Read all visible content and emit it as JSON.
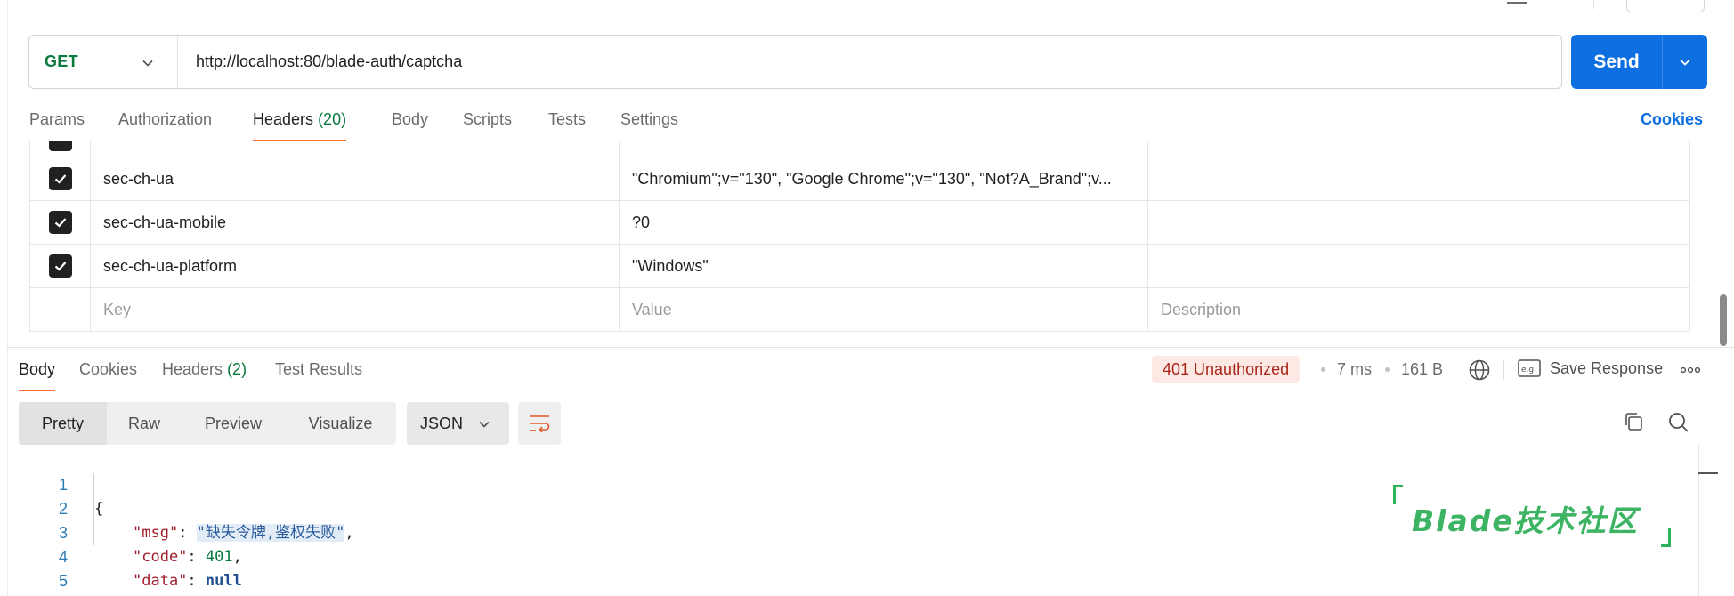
{
  "request": {
    "method": "GET",
    "url": "http://localhost:80/blade-auth/captcha",
    "send_label": "Send"
  },
  "request_tabs": {
    "params": "Params",
    "authorization": "Authorization",
    "headers": "Headers",
    "headers_count": "(20)",
    "body": "Body",
    "scripts": "Scripts",
    "tests": "Tests",
    "settings": "Settings",
    "active": "Headers",
    "cookies": "Cookies"
  },
  "headers_table": {
    "rows": [
      {
        "checked": true,
        "key": "sec-ch-ua",
        "value": "\"Chromium\";v=\"130\", \"Google Chrome\";v=\"130\", \"Not?A_Brand\";v...",
        "description": ""
      },
      {
        "checked": true,
        "key": "sec-ch-ua-mobile",
        "value": "?0",
        "description": ""
      },
      {
        "checked": true,
        "key": "sec-ch-ua-platform",
        "value": "\"Windows\"",
        "description": ""
      }
    ],
    "placeholders": {
      "key": "Key",
      "value": "Value",
      "description": "Description"
    }
  },
  "response_tabs": {
    "body": "Body",
    "cookies": "Cookies",
    "headers": "Headers",
    "headers_count": "(2)",
    "test_results": "Test Results",
    "active": "Body"
  },
  "response_meta": {
    "status": "401 Unauthorized",
    "time": "7 ms",
    "size": "161 B",
    "save_response": "Save Response"
  },
  "format_toolbar": {
    "pretty": "Pretty",
    "raw": "Raw",
    "preview": "Preview",
    "visualize": "Visualize",
    "active": "Pretty",
    "language": "JSON"
  },
  "code_lines": {
    "l1_num": "1",
    "l1_text": "{",
    "l2_num": "2",
    "l2_key": "\"msg\"",
    "l2_sep": ": ",
    "l2_value": "\"缺失令牌,鉴权失败\"",
    "l2_tail": ",",
    "l3_num": "3",
    "l3_key": "\"code\"",
    "l3_sep": ": ",
    "l3_value": "401",
    "l3_tail": ",",
    "l4_num": "4",
    "l4_key": "\"data\"",
    "l4_sep": ": ",
    "l4_value": "null",
    "l5_num": "5",
    "l5_text": "}"
  },
  "watermark": {
    "text": "Blade技术社区"
  },
  "colors": {
    "accent": "#0d6fe0",
    "method_get": "#0a7a3c",
    "active_tab_underline": "#ff6c37",
    "status_bg": "#fde8e4",
    "status_text": "#a9261b",
    "watermark": "#3cb463"
  },
  "icons": {
    "method_dropdown": "chevron-down-icon",
    "send_dropdown": "chevron-down-icon",
    "checkbox": "check-icon",
    "globe": "globe-icon",
    "save_response": "example-icon",
    "more": "more-horizontal-icon",
    "wrap": "wrap-lines-icon",
    "copy": "copy-icon",
    "search": "search-icon"
  }
}
